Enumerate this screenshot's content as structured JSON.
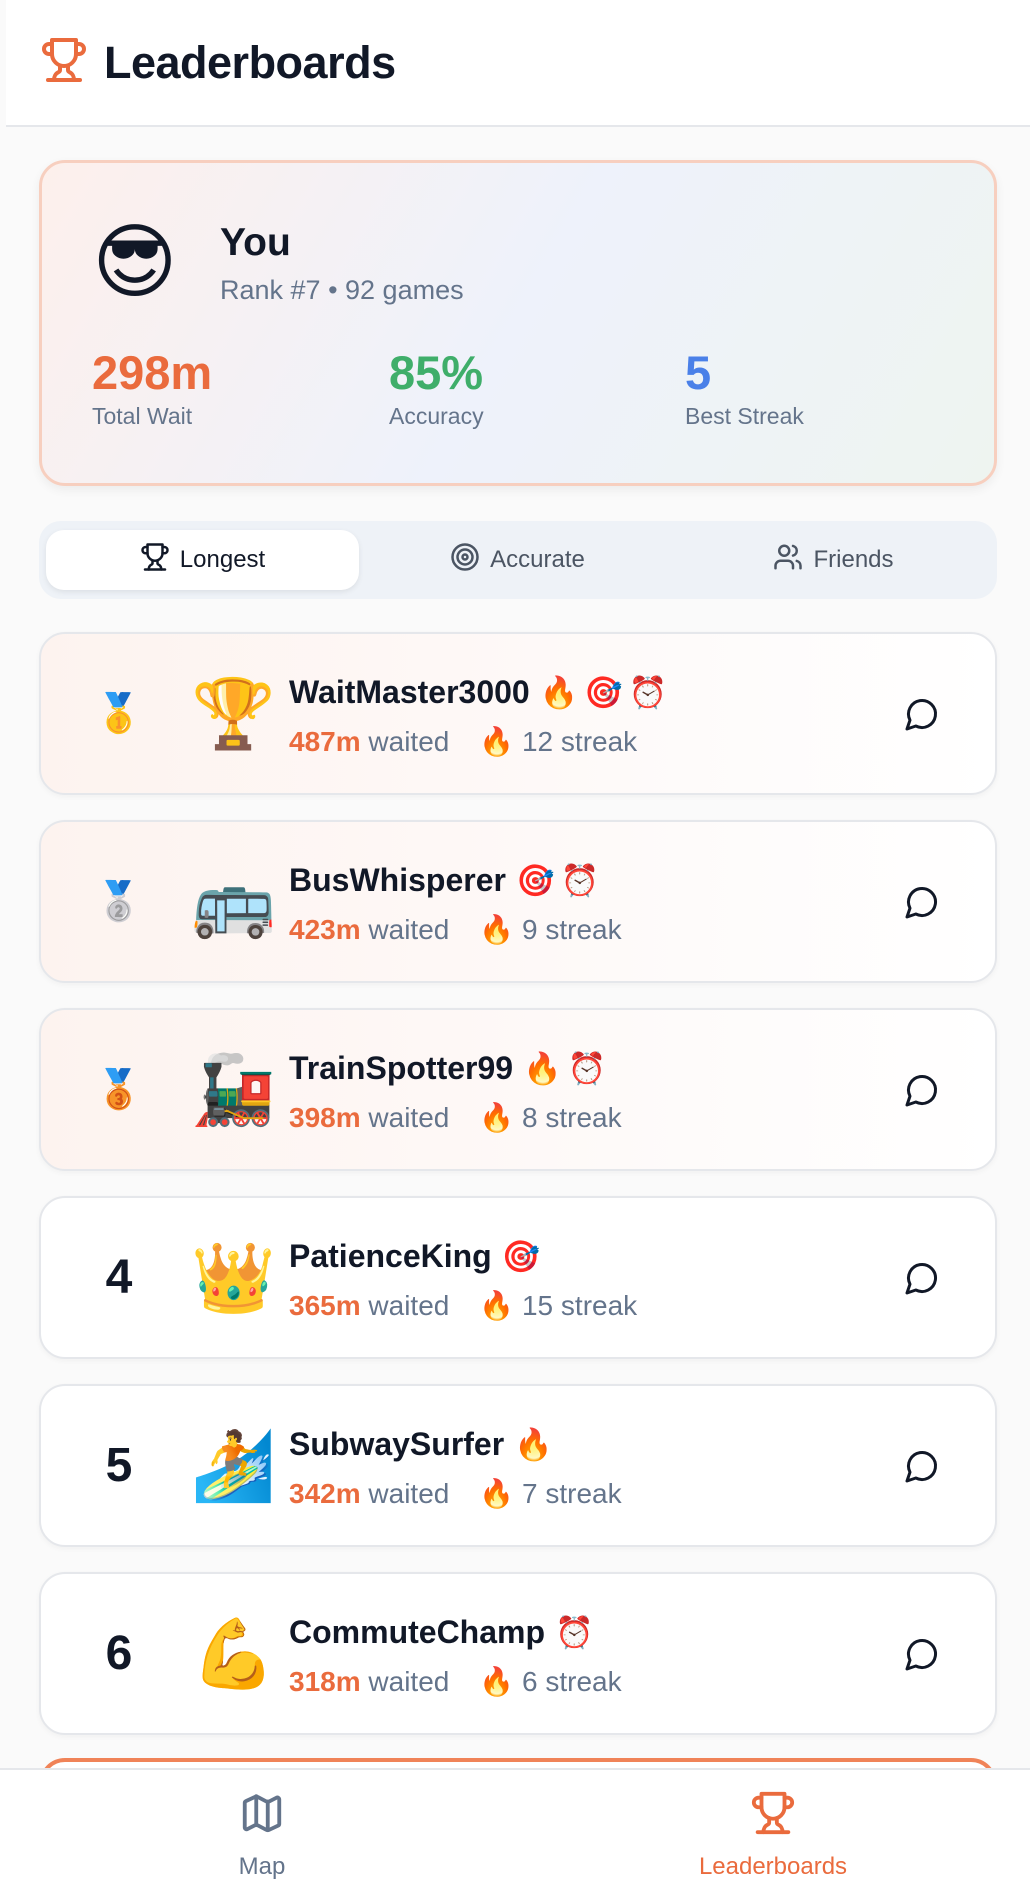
{
  "header": {
    "title": "Leaderboards",
    "icon": "trophy-icon"
  },
  "profile": {
    "avatar": "😎",
    "name": "You",
    "meta": "Rank #7 • 92 games",
    "stats": [
      {
        "value": "298m",
        "label": "Total Wait",
        "color": "#ea6b3d"
      },
      {
        "value": "85%",
        "label": "Accuracy",
        "color": "#3fae6a"
      },
      {
        "value": "5",
        "label": "Best Streak",
        "color": "#4a80e8"
      }
    ]
  },
  "tabs": [
    {
      "label": "Longest",
      "icon": "trophy-icon",
      "active": true
    },
    {
      "label": "Accurate",
      "icon": "target-icon",
      "active": false
    },
    {
      "label": "Friends",
      "icon": "users-icon",
      "active": false
    }
  ],
  "rows": [
    {
      "rank": "1",
      "medal": "🥇",
      "avatar": "🏆",
      "name": "WaitMaster3000",
      "badges": "🔥🎯⏰",
      "wait": "487m",
      "waited_label": "waited",
      "streak": "🔥 12 streak"
    },
    {
      "rank": "2",
      "medal": "🥈",
      "avatar": "🚌",
      "name": "BusWhisperer",
      "badges": "🎯⏰",
      "wait": "423m",
      "waited_label": "waited",
      "streak": "🔥 9 streak"
    },
    {
      "rank": "3",
      "medal": "🥉",
      "avatar": "🚂",
      "name": "TrainSpotter99",
      "badges": "🔥⏰",
      "wait": "398m",
      "waited_label": "waited",
      "streak": "🔥 8 streak"
    },
    {
      "rank": "4",
      "medal": "",
      "avatar": "👑",
      "name": "PatienceKing",
      "badges": "🎯",
      "wait": "365m",
      "waited_label": "waited",
      "streak": "🔥 15 streak"
    },
    {
      "rank": "5",
      "medal": "",
      "avatar": "🏄",
      "name": "SubwaySurfer",
      "badges": "🔥",
      "wait": "342m",
      "waited_label": "waited",
      "streak": "🔥 7 streak"
    },
    {
      "rank": "6",
      "medal": "",
      "avatar": "💪",
      "name": "CommuteChamp",
      "badges": "⏰",
      "wait": "318m",
      "waited_label": "waited",
      "streak": "🔥 6 streak"
    }
  ],
  "nav": [
    {
      "label": "Map",
      "icon": "map-icon",
      "active": false
    },
    {
      "label": "Leaderboards",
      "icon": "trophy-icon",
      "active": true
    }
  ],
  "colors": {
    "accent": "#ea6b3d",
    "muted": "#64748b",
    "text": "#111827"
  }
}
